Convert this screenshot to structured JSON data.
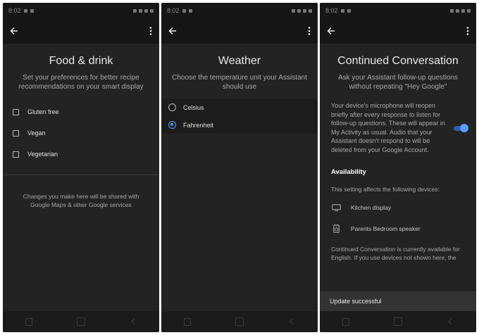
{
  "status": {
    "time": "8:02"
  },
  "screen1": {
    "title": "Food & drink",
    "subtitle": "Set your preferences for better recipe recommendations on your smart display",
    "options": [
      "Gluten free",
      "Vegan",
      "Vegetarian"
    ],
    "note": "Changes you make here will be shared with Google Maps & other Google services"
  },
  "screen2": {
    "title": "Weather",
    "subtitle": "Choose the temperature unit your Assistant should use",
    "units": [
      {
        "label": "Celsius",
        "selected": false
      },
      {
        "label": "Fahrenheit",
        "selected": true
      }
    ]
  },
  "screen3": {
    "title": "Continued Conversation",
    "subtitle": "Ask your Assistant follow-up questions without repeating \"Hey Google\"",
    "description": "Your device's microphone will reopen briefly after every response to listen for follow-up questions. These will appear in My Activity as usual. Audio that your Assistant doesn't respond to will be deleted from your Google Account.",
    "toggle_on": true,
    "availability_heading": "Availability",
    "availability_sub": "This setting affects the following devices:",
    "devices": [
      {
        "name": "Kitchen display",
        "icon": "display-icon"
      },
      {
        "name": "Parents Bedroom speaker",
        "icon": "speaker-icon"
      }
    ],
    "footnote": "Continued Conversation is currently available for English. If you use devices not shown here, the",
    "snackbar": "Update successful"
  },
  "colors": {
    "accent": "#5b9cff",
    "background": "#232323",
    "bar": "#161616"
  }
}
